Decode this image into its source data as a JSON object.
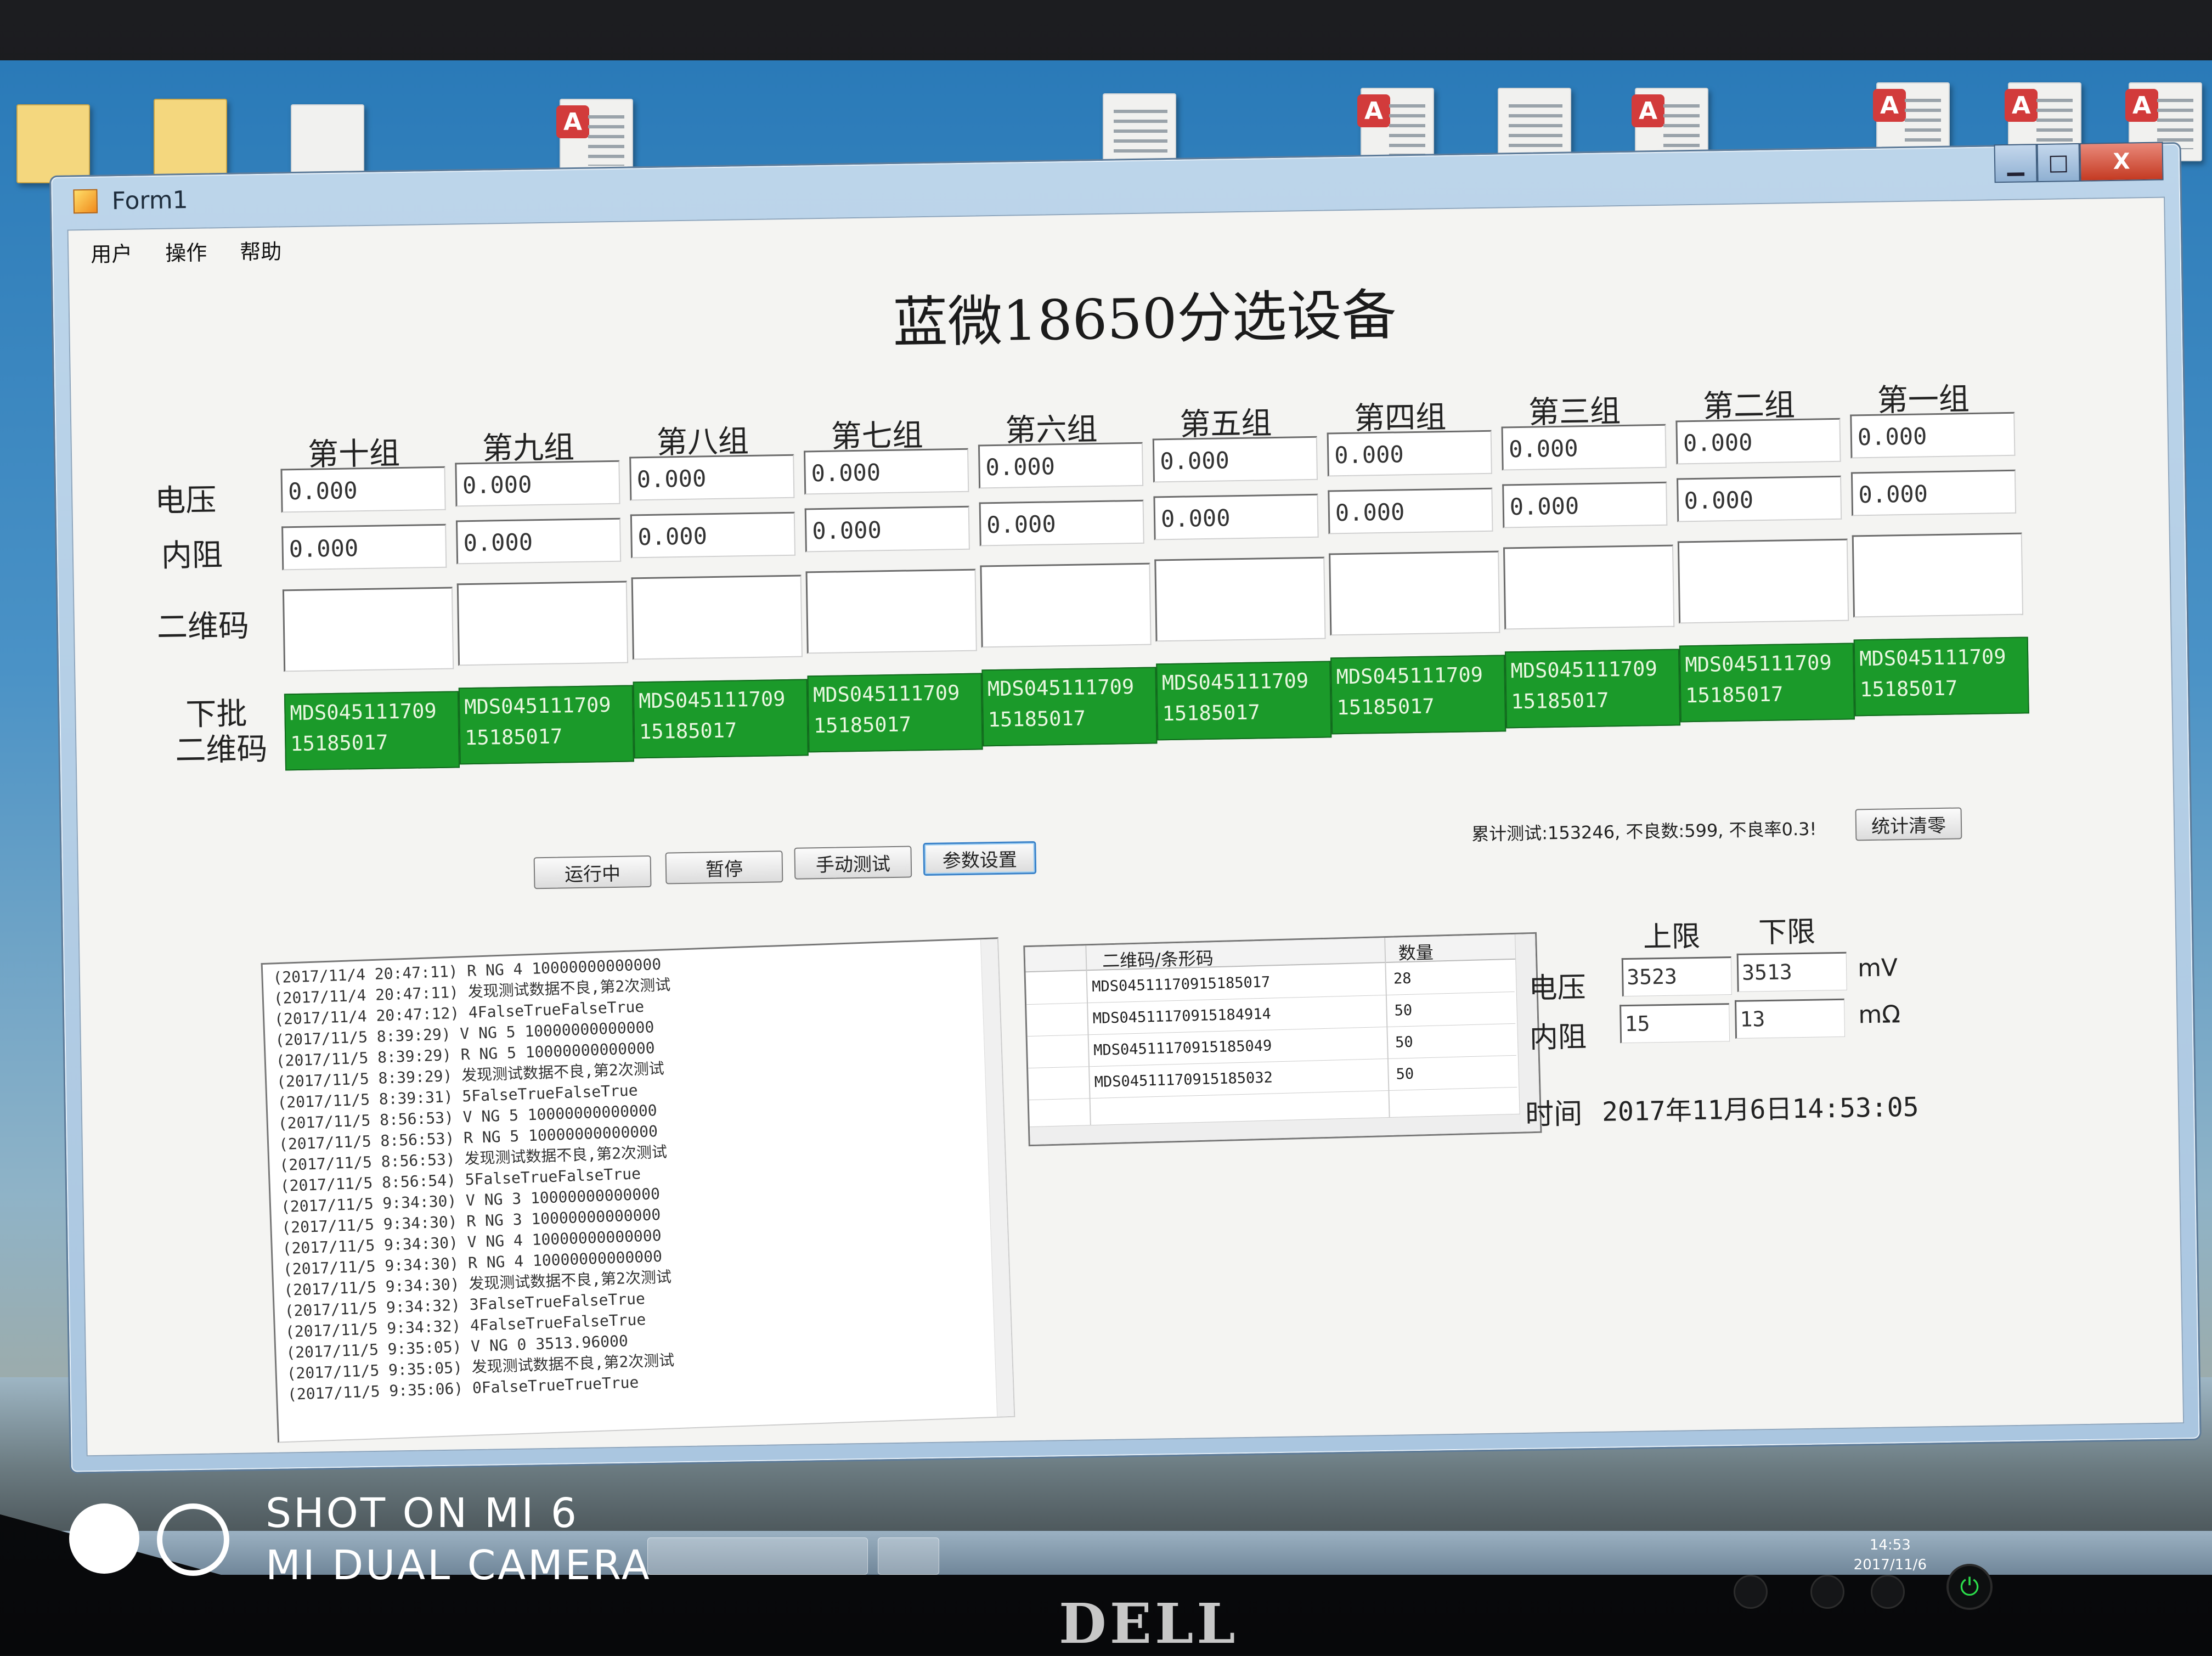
{
  "window": {
    "title": "Form1",
    "buttons": {
      "minimize": "▁",
      "maximize": "□",
      "close": "X"
    }
  },
  "menu": [
    "用户",
    "操作",
    "帮助"
  ],
  "main_title": "蓝微18650分选设备",
  "row_labels": {
    "voltage": "电压",
    "resistance": "内阻",
    "qr": "二维码",
    "next_qr_1": "下批",
    "next_qr_2": "二维码"
  },
  "groups": [
    {
      "name": "第十组",
      "voltage": "0.000",
      "resistance": "0.000",
      "next_qr_1": "MDS045111709",
      "next_qr_2": "15185017"
    },
    {
      "name": "第九组",
      "voltage": "0.000",
      "resistance": "0.000",
      "next_qr_1": "MDS045111709",
      "next_qr_2": "15185017"
    },
    {
      "name": "第八组",
      "voltage": "0.000",
      "resistance": "0.000",
      "next_qr_1": "MDS045111709",
      "next_qr_2": "15185017"
    },
    {
      "name": "第七组",
      "voltage": "0.000",
      "resistance": "0.000",
      "next_qr_1": "MDS045111709",
      "next_qr_2": "15185017"
    },
    {
      "name": "第六组",
      "voltage": "0.000",
      "resistance": "0.000",
      "next_qr_1": "MDS045111709",
      "next_qr_2": "15185017"
    },
    {
      "name": "第五组",
      "voltage": "0.000",
      "resistance": "0.000",
      "next_qr_1": "MDS045111709",
      "next_qr_2": "15185017"
    },
    {
      "name": "第四组",
      "voltage": "0.000",
      "resistance": "0.000",
      "next_qr_1": "MDS045111709",
      "next_qr_2": "15185017"
    },
    {
      "name": "第三组",
      "voltage": "0.000",
      "resistance": "0.000",
      "next_qr_1": "MDS045111709",
      "next_qr_2": "15185017"
    },
    {
      "name": "第二组",
      "voltage": "0.000",
      "resistance": "0.000",
      "next_qr_1": "MDS045111709",
      "next_qr_2": "15185017"
    },
    {
      "name": "第一组",
      "voltage": "0.000",
      "resistance": "0.000",
      "next_qr_1": "MDS045111709",
      "next_qr_2": "15185017"
    }
  ],
  "buttons": {
    "running": "运行中",
    "pause": "暂停",
    "manual_test": "手动测试",
    "params": "参数设置",
    "reset_stats": "统计清零"
  },
  "stats_text": "累计测试:153246, 不良数:599, 不良率0.3!",
  "log_lines": [
    "(2017/11/4 20:47:11) R NG 4 10000000000000",
    "(2017/11/4 20:47:11) 发现测试数据不良,第2次测试",
    "(2017/11/4 20:47:12) 4FalseTrueFalseTrue",
    "(2017/11/5 8:39:29) V NG 5 10000000000000",
    "(2017/11/5 8:39:29) R NG 5 10000000000000",
    "(2017/11/5 8:39:29) 发现测试数据不良,第2次测试",
    "(2017/11/5 8:39:31) 5FalseTrueFalseTrue",
    "(2017/11/5 8:56:53) V NG 5 10000000000000",
    "(2017/11/5 8:56:53) R NG 5 10000000000000",
    "(2017/11/5 8:56:53) 发现测试数据不良,第2次测试",
    "(2017/11/5 8:56:54) 5FalseTrueFalseTrue",
    "(2017/11/5 9:34:30) V NG 3 10000000000000",
    "(2017/11/5 9:34:30) R NG 3 10000000000000",
    "(2017/11/5 9:34:30) V NG 4 10000000000000",
    "(2017/11/5 9:34:30) R NG 4 10000000000000",
    "(2017/11/5 9:34:30) 发现测试数据不良,第2次测试",
    "(2017/11/5 9:34:32) 3FalseTrueFalseTrue",
    "(2017/11/5 9:34:32) 4FalseTrueFalseTrue",
    "(2017/11/5 9:35:05) V NG 0 3513.96000",
    "(2017/11/5 9:35:05) 发现测试数据不良,第2次测试",
    "(2017/11/5 9:35:06) 0FalseTrueTrueTrue"
  ],
  "table": {
    "headers": [
      "二维码/条形码",
      "数量"
    ],
    "rows": [
      {
        "code": "MDS04511170915185017",
        "qty": "28"
      },
      {
        "code": "MDS04511170915184914",
        "qty": "50"
      },
      {
        "code": "MDS04511170915185049",
        "qty": "50"
      },
      {
        "code": "MDS04511170915185032",
        "qty": "50"
      }
    ]
  },
  "limits": {
    "upper_label": "上限",
    "lower_label": "下限",
    "voltage_label": "电压",
    "resistance_label": "内阻",
    "voltage_upper": "3523",
    "voltage_lower": "3513",
    "voltage_unit": "mV",
    "resistance_upper": "15",
    "resistance_lower": "13",
    "resistance_unit": "mΩ"
  },
  "time": {
    "label": "时间",
    "value": "2017年11月6日14:53:05"
  },
  "taskbar": {
    "clock_time": "14:53",
    "clock_date": "2017/11/6"
  },
  "monitor_brand": "DELL",
  "watermark": {
    "line1": "SHOT ON MI 6",
    "line2": "MI DUAL CAMERA"
  },
  "colors": {
    "green_box": "#1b9a2a",
    "window_frame": "#bcd5ea",
    "close_button": "#c43a22"
  }
}
